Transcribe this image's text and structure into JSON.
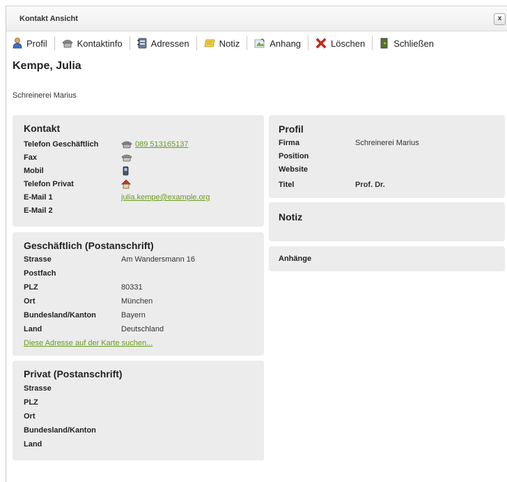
{
  "window": {
    "title": "Kontakt Ansicht",
    "close_label": "x"
  },
  "toolbar": {
    "profil": "Profil",
    "kontaktinfo": "Kontaktinfo",
    "adressen": "Adressen",
    "notiz": "Notiz",
    "anhang": "Anhang",
    "loeschen": "Löschen",
    "schliessen": "Schließen"
  },
  "contact": {
    "name": "Kempe, Julia",
    "company": "Schreinerei Marius"
  },
  "kontakt": {
    "title": "Kontakt",
    "telefon_geschaeftlich_label": "Telefon Geschäftlich",
    "telefon_geschaeftlich_value": "089 513165137",
    "fax_label": "Fax",
    "mobil_label": "Mobil",
    "telefon_privat_label": "Telefon Privat",
    "email1_label": "E-Mail 1",
    "email1_value": "julia.kempe@example.org",
    "email2_label": "E-Mail 2"
  },
  "geschaeftlich": {
    "title": "Geschäftlich (Postanschrift)",
    "strasse_label": "Strasse",
    "strasse_value": "Am Wandersmann 16",
    "postfach_label": "Postfach",
    "plz_label": "PLZ",
    "plz_value": "80331",
    "ort_label": "Ort",
    "ort_value": "München",
    "bundesland_label": "Bundesland/Kanton",
    "bundesland_value": "Bayern",
    "land_label": "Land",
    "land_value": "Deutschland",
    "map_link": "Diese Adresse auf der Karte suchen..."
  },
  "privat": {
    "title": "Privat (Postanschrift)",
    "strasse_label": "Strasse",
    "plz_label": "PLZ",
    "ort_label": "Ort",
    "bundesland_label": "Bundesland/Kanton",
    "land_label": "Land"
  },
  "profil": {
    "title": "Profil",
    "firma_label": "Firma",
    "firma_value": "Schreinerei Marius",
    "position_label": "Position",
    "website_label": "Website",
    "titel_label": "Titel",
    "titel_value": "Prof. Dr."
  },
  "notiz": {
    "title": "Notiz"
  },
  "anhaenge": {
    "title": "Anhänge"
  },
  "colors": {
    "panel_bg": "#ececec",
    "link": "#6a9a1f",
    "delete_red": "#d42b1e"
  }
}
